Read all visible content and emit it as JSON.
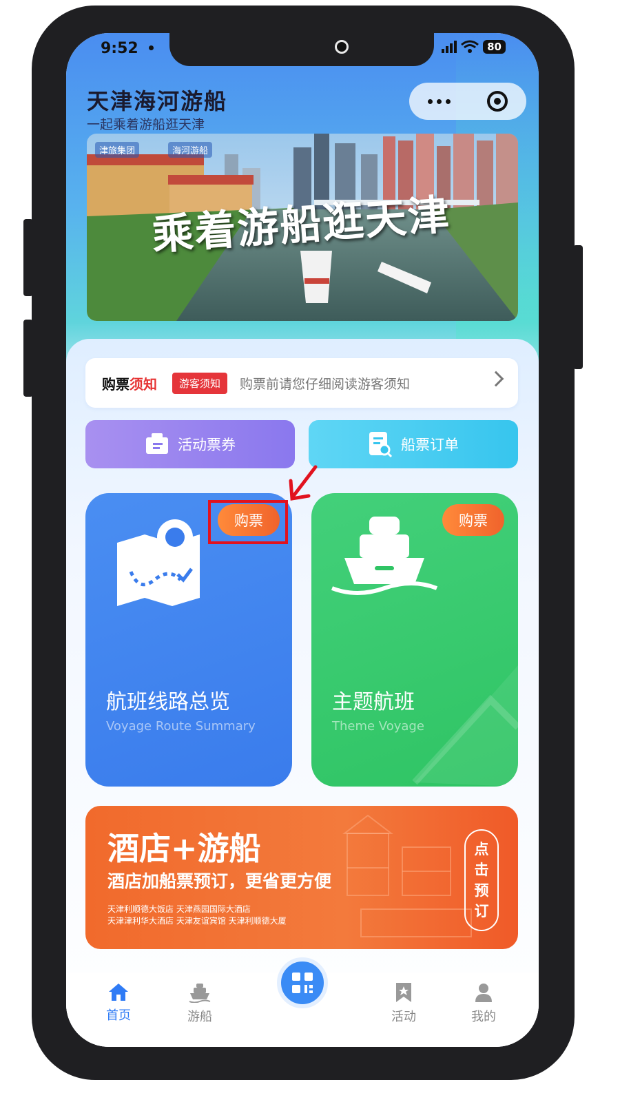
{
  "status_bar": {
    "time": "9:52",
    "battery": "80"
  },
  "header": {
    "title": "天津海河游船",
    "subtitle": "一起乘着游船逛天津"
  },
  "banner": {
    "headline": "乘着游船逛天津",
    "logo_left": "津旅集团",
    "logo_right": "海河游船"
  },
  "notice": {
    "title_black": "购票",
    "title_red": "须知",
    "tag": "游客须知",
    "text": "购票前请您仔细阅读游客须知"
  },
  "quick_buttons": {
    "left": "活动票券",
    "right": "船票订单"
  },
  "cards": {
    "route": {
      "buy_label": "购票",
      "title": "航班线路总览",
      "subtitle": "Voyage Route Summary"
    },
    "theme": {
      "buy_label": "购票",
      "title": "主题航班",
      "subtitle": "Theme Voyage"
    }
  },
  "hotel": {
    "title": "酒店+游船",
    "subtitle": "酒店加船票预订，更省更方便",
    "names_line1": "天津利顺德大饭店  天津燕园国际大酒店",
    "names_line2": "天津津利华大酒店  天津友谊宾馆  天津利顺德大厦",
    "cta": [
      "点",
      "击",
      "预",
      "订"
    ]
  },
  "tabbar": {
    "home": "首页",
    "boat": "游船",
    "activity": "活动",
    "mine": "我的"
  },
  "colors": {
    "accent": "#2f7bf5",
    "buy_orange": "#f0632c",
    "highlight_red": "#e1121e",
    "green_card": "#2fc464"
  }
}
